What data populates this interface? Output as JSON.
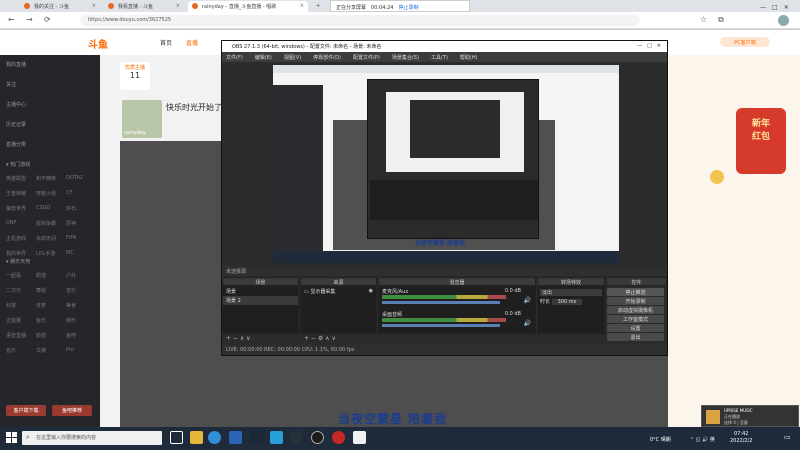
{
  "browser": {
    "tabs": [
      {
        "label": "我的关注 - 斗鱼"
      },
      {
        "label": "我看直播 - 斗鱼"
      },
      {
        "label": "rainyday - 直播_斗鱼直播 - 唱歌"
      },
      {
        "label": "斗鱼"
      }
    ],
    "url": "https://www.douyu.com/3627525",
    "recorder": {
      "label": "正在分享屏幕",
      "time": "00:04:24",
      "stop": "停止录制"
    }
  },
  "site": {
    "logo": "斗鱼",
    "nav": [
      "首页",
      "直播"
    ],
    "right_badge": "PC客户端",
    "promo": {
      "line1": "新年",
      "line2": "红包"
    },
    "sidebar": {
      "items": [
        "我的直播",
        "关注",
        "主播中心",
        "历史记录",
        "直播分类"
      ],
      "grid": [
        [
          "英雄联盟",
          "和平精英",
          "DOTA2"
        ],
        [
          "王者荣耀",
          "穿越火线",
          "CF"
        ],
        [
          "魔兽世界",
          "CSGO",
          "炉石"
        ],
        [
          "DNF",
          "星际争霸",
          "原神"
        ],
        [
          "主机游戏",
          "永劫无间",
          "FIFA"
        ],
        [
          "我的世界",
          "LOL手游",
          "MC"
        ]
      ],
      "grid2": [
        [
          "一起看",
          "颜值",
          "户外"
        ],
        [
          "二次元",
          "舞蹈",
          "音乐"
        ],
        [
          "科技",
          "体育",
          "美食"
        ],
        [
          "正能量",
          "鱼乐",
          "娱乐"
        ],
        [
          "语音直播",
          "颜值",
          "鱼吧"
        ],
        [
          "音乐",
          "文娱",
          "Pro"
        ]
      ],
      "buttons": [
        "客户端下载",
        "鱼吧推荐"
      ]
    },
    "stream": {
      "headline": "快乐时光开始了",
      "streamer": "rainyday",
      "follow_count": "11",
      "badge": "优质主播"
    },
    "subtitle": "当夜空繁星 陪着我"
  },
  "obs": {
    "title": "OBS 27.1.3 (64-bit, windows) - 配置文件: 未命名 - 场景: 未命名",
    "menu": [
      "文件(F)",
      "编辑(E)",
      "视图(V)",
      "停靠部件(D)",
      "配置文件(P)",
      "场景集合(S)",
      "工具(T)",
      "帮助(H)"
    ],
    "docks": {
      "scenes": "场景",
      "sources": "来源",
      "mixer": "混音器",
      "transitions": "转场特效",
      "controls": "控件"
    },
    "scene_items": [
      "场景",
      "场景 2"
    ],
    "source_items": [
      "显示器采集"
    ],
    "mixer_items": [
      {
        "name": "麦克风/Aux",
        "db": "0.0 dB"
      },
      {
        "name": "桌面音频",
        "db": "0.0 dB"
      }
    ],
    "transition": {
      "type": "淡出",
      "duration_label": "时长",
      "duration": "300 ms"
    },
    "controls": [
      "停止推流",
      "开始录制",
      "启动虚拟摄像机",
      "工作室模式",
      "设置",
      "退出"
    ],
    "status": "LIVE: 00:00:00   REC: 00:00:00   CPU: 1.1%, 60.00 fps",
    "no_scene": "未选择源"
  },
  "taskbar": {
    "search_placeholder": "在这里输入你要搜索的内容",
    "time": "07:42",
    "date": "2022/2/2",
    "weather": "0°C 晴朗",
    "toast": {
      "title": "UPRISE MUSIC",
      "line1": "正在播放",
      "line2": "选择 X | 音量"
    }
  }
}
